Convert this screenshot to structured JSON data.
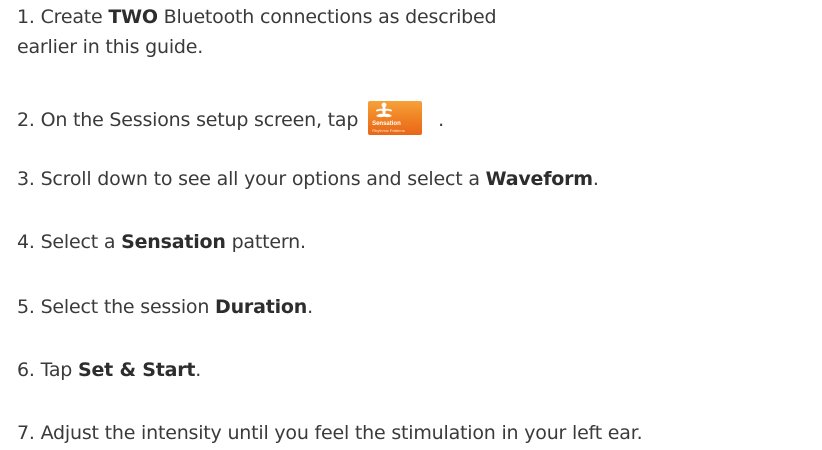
{
  "steps": [
    {
      "number": "1.",
      "pre": " Create ",
      "bold": "TWO",
      "post": " Bluetooth connections as described",
      "line2": "earlier in this guide."
    },
    {
      "number": "2.",
      "pre": " On the Sessions setup screen, tap ",
      "post": ".",
      "tile": {
        "title": "Sensation",
        "subtitle": "Rhythmic Patterns",
        "icon": "meditation-person-icon",
        "color": "#ef7f22"
      }
    },
    {
      "number": "3.",
      "pre": " Scroll down to see all your options and select a ",
      "bold": "Waveform",
      "post": "."
    },
    {
      "number": "4.",
      "pre": " Select a ",
      "bold": "Sensation",
      "post": " pattern."
    },
    {
      "number": "5.",
      "pre": " Select the session ",
      "bold": "Duration",
      "post": "."
    },
    {
      "number": "6.",
      "pre": " Tap ",
      "bold": "Set & Start",
      "post": "."
    },
    {
      "number": "7.",
      "pre": " Adjust the intensity until you feel the stimulation in your left ear."
    }
  ]
}
